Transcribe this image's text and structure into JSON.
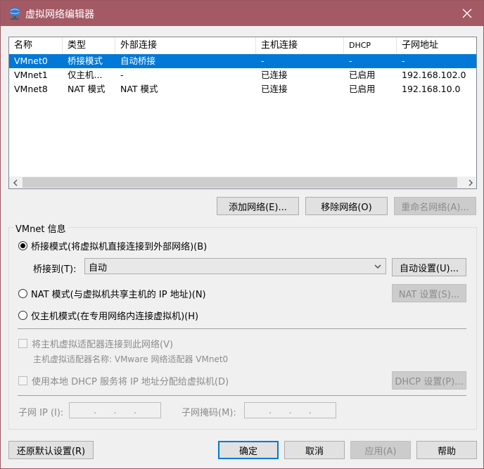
{
  "window": {
    "title": "虚拟网络编辑器",
    "title_bar_color": "#a45a65"
  },
  "network_list": {
    "columns": [
      "名称",
      "类型",
      "外部连接",
      "主机连接",
      "DHCP",
      "子网地址"
    ],
    "rows": [
      {
        "name": "VMnet0",
        "type": "桥接模式",
        "external": "自动桥接",
        "host": "-",
        "dhcp": "-",
        "subnet": "-",
        "selected": true
      },
      {
        "name": "VMnet1",
        "type": "仅主机...",
        "external": "-",
        "host": "已连接",
        "dhcp": "已启用",
        "subnet": "192.168.102.0",
        "selected": false
      },
      {
        "name": "VMnet8",
        "type": "NAT 模式",
        "external": "NAT 模式",
        "host": "已连接",
        "dhcp": "已启用",
        "subnet": "192.168.10.0",
        "selected": false
      }
    ],
    "selection_color": "#0078d7"
  },
  "list_buttons": {
    "add": "添加网络(E)...",
    "remove": "移除网络(O)",
    "rename": "重命名网络(A)..."
  },
  "vmnet_info": {
    "group_title": "VMnet 信息",
    "bridged_radio": "桥接模式(将虚拟机直接连接到外部网络)(B)",
    "bridge_to_label": "桥接到(T):",
    "bridge_to_value": "自动",
    "auto_settings": "自动设置(U)...",
    "nat_radio": "NAT 模式(与虚拟机共享主机的 IP 地址)(N)",
    "nat_settings": "NAT 设置(S)...",
    "hostonly_radio": "仅主机模式(在专用网络内连接虚拟机)(H)",
    "connect_adapter_check": "将主机虚拟适配器连接到此网络(V)",
    "adapter_name_label": "主机虚拟适配器名称: VMware 网络适配器 VMnet0",
    "dhcp_check": "使用本地 DHCP 服务将 IP 地址分配给虚拟机(D)",
    "dhcp_settings": "DHCP 设置(P)...",
    "subnet_ip_label": "子网 IP (I):",
    "subnet_mask_label": "子网掩码(M):",
    "ip_dot": "."
  },
  "footer": {
    "restore_defaults": "还原默认设置(R)",
    "ok": "确定",
    "cancel": "取消",
    "apply": "应用(A)",
    "help": "帮助"
  }
}
